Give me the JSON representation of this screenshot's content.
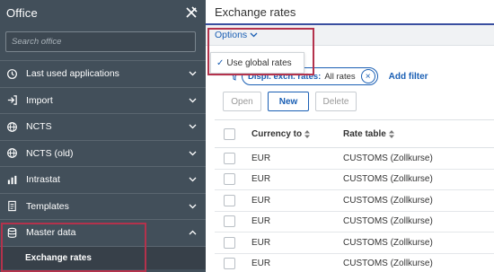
{
  "sidebar": {
    "title": "Office",
    "search_placeholder": "Search office",
    "items": [
      {
        "label": "Last used applications",
        "icon": "clock-history-icon"
      },
      {
        "label": "Import",
        "icon": "import-icon"
      },
      {
        "label": "NCTS",
        "icon": "globe-icon"
      },
      {
        "label": "NCTS (old)",
        "icon": "globe-icon"
      },
      {
        "label": "Intrastat",
        "icon": "chart-icon"
      },
      {
        "label": "Templates",
        "icon": "template-icon"
      },
      {
        "label": "Master data",
        "icon": "database-icon",
        "expanded": true
      }
    ],
    "sub_item": "Exchange rates"
  },
  "main": {
    "title": "Exchange rates",
    "options_label": "Options",
    "dropdown": {
      "checked": true,
      "label": "Use global rates"
    },
    "filter": {
      "key": "Displ. exch. rates:",
      "value": "All rates",
      "add_label": "Add filter"
    },
    "buttons": {
      "open": "Open",
      "new": "New",
      "delete": "Delete"
    },
    "columns": [
      "Currency to",
      "Rate table"
    ],
    "rows": [
      [
        "EUR",
        "CUSTOMS (Zollkurse)"
      ],
      [
        "EUR",
        "CUSTOMS (Zollkurse)"
      ],
      [
        "EUR",
        "CUSTOMS (Zollkurse)"
      ],
      [
        "EUR",
        "CUSTOMS (Zollkurse)"
      ],
      [
        "EUR",
        "CUSTOMS (Zollkurse)"
      ],
      [
        "EUR",
        "CUSTOMS (Zollkurse)"
      ]
    ]
  },
  "colors": {
    "sidebar_bg": "#424f5a",
    "accent": "#1a5fb4",
    "highlight": "#b4324c"
  }
}
